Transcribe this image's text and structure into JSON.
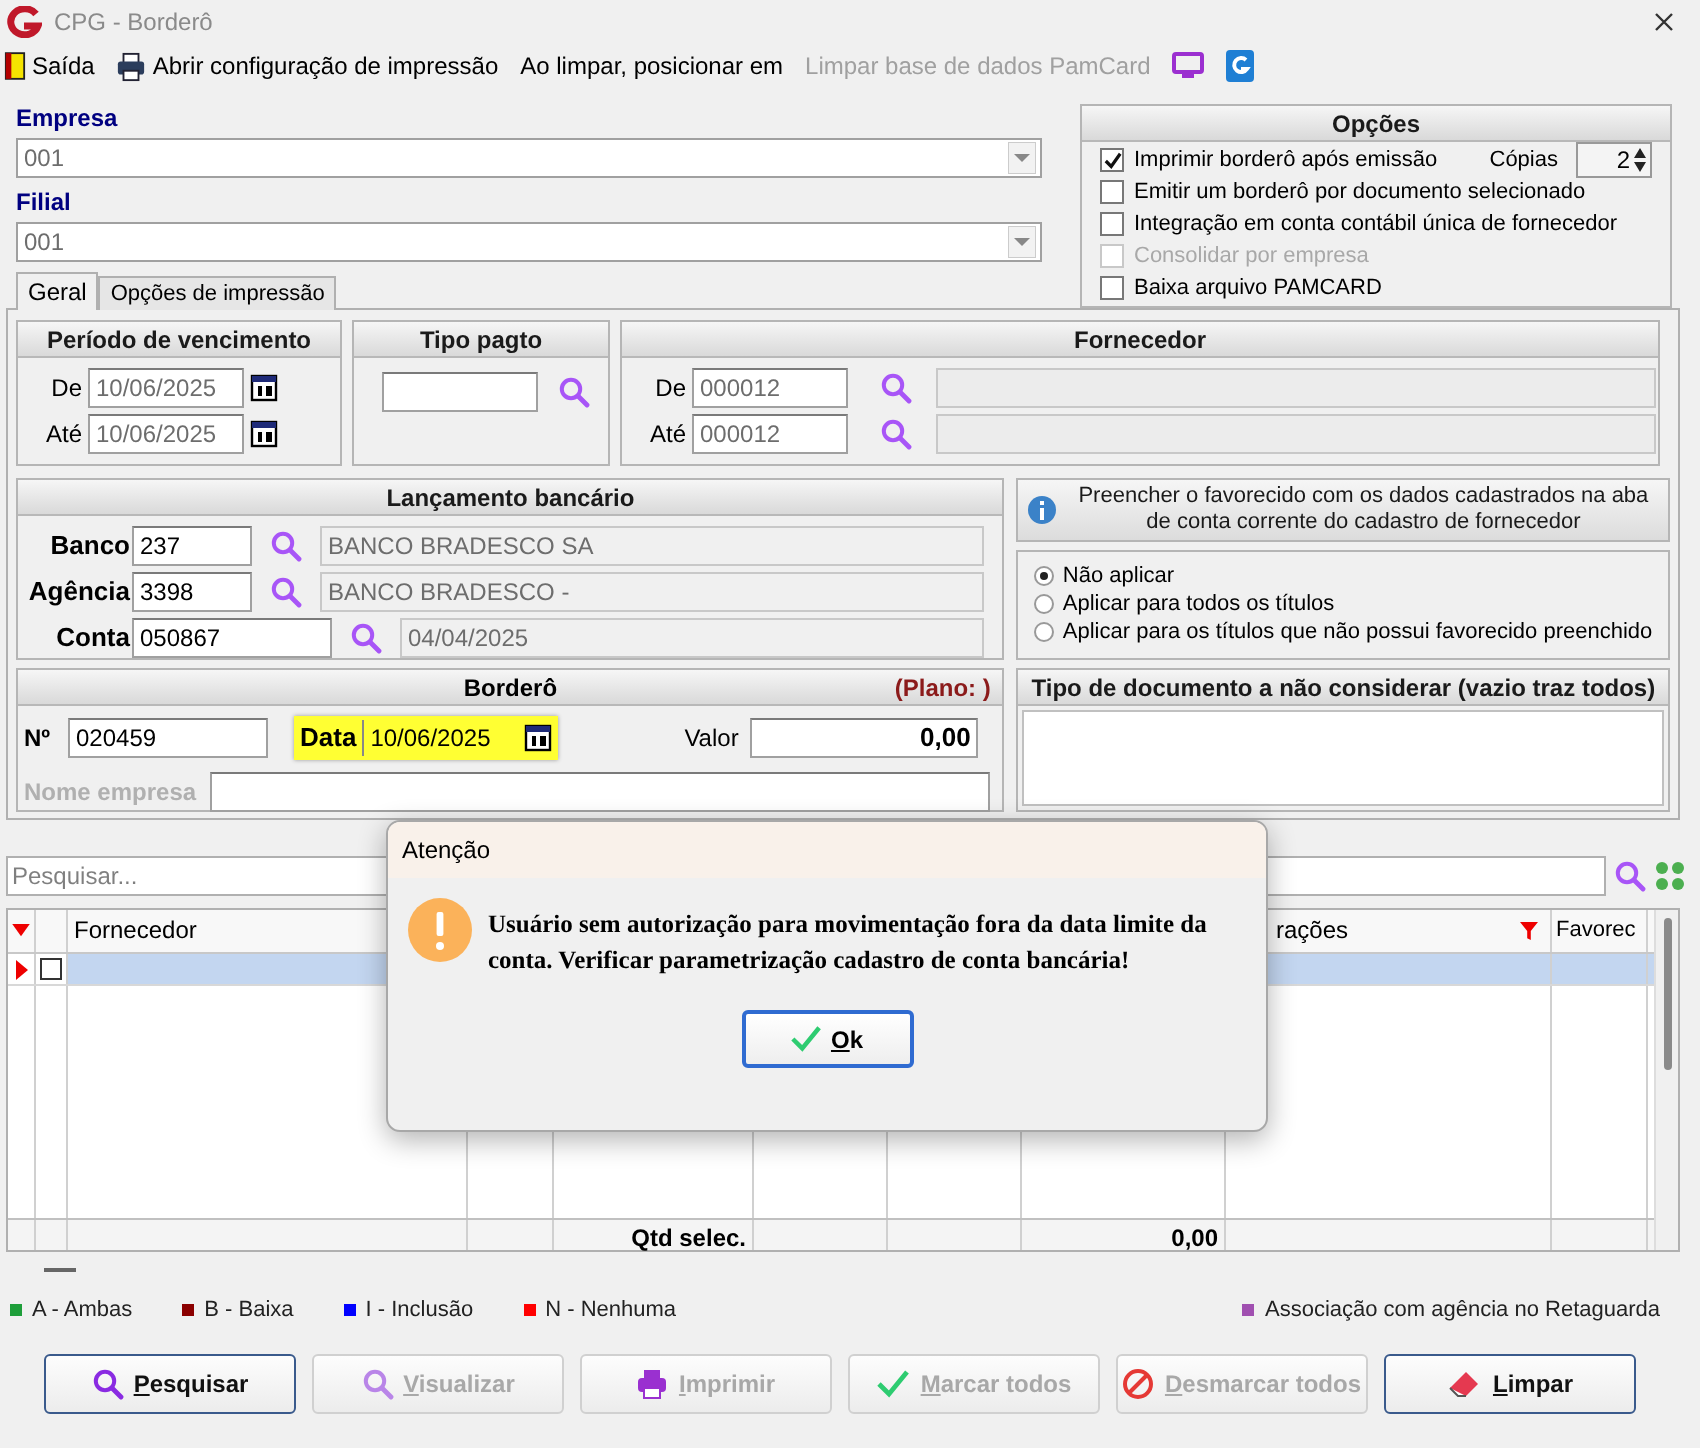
{
  "window": {
    "title": "CPG - Borderô"
  },
  "toolbar": [
    {
      "kind": "exit",
      "label": "Saída",
      "disabled": false
    },
    {
      "kind": "print",
      "label": "Abrir configuração de impressão",
      "disabled": false
    },
    {
      "kind": "text",
      "label": "Ao limpar, posicionar em",
      "disabled": false
    },
    {
      "kind": "text",
      "label": "Limpar base de dados PamCard",
      "disabled": true
    }
  ],
  "empresa": {
    "label": "Empresa",
    "value": "001"
  },
  "filial": {
    "label": "Filial",
    "value": "001"
  },
  "tabs": [
    {
      "label": "Geral",
      "selected": true
    },
    {
      "label": "Opções de impressão",
      "selected": false
    }
  ],
  "opcoes": {
    "title": "Opções",
    "copies_label": "Cópias",
    "copies": "2",
    "items": [
      {
        "label": "Imprimir borderô após emissão",
        "checked": true,
        "disabled": false
      },
      {
        "label": "Emitir um borderô por documento selecionado",
        "checked": false,
        "disabled": false
      },
      {
        "label": "Integração em conta contábil única de fornecedor",
        "checked": false,
        "disabled": false
      },
      {
        "label": "Consolidar por empresa",
        "checked": false,
        "disabled": true
      },
      {
        "label": "Baixa arquivo PAMCARD",
        "checked": false,
        "disabled": false
      }
    ]
  },
  "periodo": {
    "title": "Período de vencimento",
    "from_label": "De",
    "from": "10/06/2025",
    "to_label": "Até",
    "to": "10/06/2025"
  },
  "tipo_pagto": {
    "title": "Tipo pagto"
  },
  "fornecedor": {
    "title": "Fornecedor",
    "from_label": "De",
    "from": "000012",
    "to_label": "Até",
    "to": "000012"
  },
  "lancamento": {
    "title": "Lançamento bancário",
    "rows": [
      {
        "label": "Banco",
        "code": "237",
        "description": "BANCO BRADESCO SA"
      },
      {
        "label": "Agência",
        "code": "3398",
        "description": "BANCO BRADESCO -"
      },
      {
        "label": "Conta",
        "code": "050867",
        "description": "04/04/2025"
      }
    ]
  },
  "favorecido": {
    "info": "Preencher o favorecido com os dados cadastrados na aba de conta corrente do cadastro de fornecedor",
    "options": [
      {
        "label": "Não aplicar",
        "selected": true
      },
      {
        "label": "Aplicar para todos os títulos",
        "selected": false
      },
      {
        "label": "Aplicar para os títulos que não possui favorecido preenchido",
        "selected": false
      }
    ]
  },
  "bordero": {
    "title": "Borderô",
    "plan": "(Plano:  )",
    "number_label": "Nº",
    "number": "020459",
    "date_label": "Data",
    "date": "10/06/2025",
    "value_label": "Valor",
    "value": "0,00",
    "company_label": "Nome empresa"
  },
  "tipo_documento": {
    "title": "Tipo de documento a não considerar (vazio traz todos)"
  },
  "search": {
    "placeholder": "Pesquisar..."
  },
  "table": {
    "columns": [
      "Fornecedor",
      "rações",
      "Favorec"
    ],
    "rows": [
      {
        "selected": true,
        "checked": false
      }
    ],
    "footer_label": "Qtd selec.",
    "footer_total": "0,00"
  },
  "legend": [
    {
      "label": "A - Ambas",
      "color": "#1e9e3a"
    },
    {
      "label": "B - Baixa",
      "color": "#8b0000"
    },
    {
      "label": "I - Inclusão",
      "color": "#0000ff"
    },
    {
      "label": "N - Nenhuma",
      "color": "#ff0000"
    }
  ],
  "association": {
    "label": "Associação com agência no Retaguarda",
    "color": "#a04fb0"
  },
  "buttons": [
    {
      "kind": "search",
      "label": "Pesquisar",
      "disabled": false
    },
    {
      "kind": "view",
      "label": "Visualizar",
      "disabled": true
    },
    {
      "kind": "print",
      "label": "Imprimir",
      "disabled": true
    },
    {
      "kind": "check",
      "label": "Marcar todos",
      "disabled": true
    },
    {
      "kind": "uncheck",
      "label": "Desmarcar todos",
      "disabled": true
    },
    {
      "kind": "clear",
      "label": "Limpar",
      "disabled": false
    }
  ],
  "dialog": {
    "title": "Atenção",
    "message": "Usuário sem autorização para movimentação fora da data limite da conta. Verificar parametrização cadastro de conta bancária!",
    "button": "Ok"
  }
}
